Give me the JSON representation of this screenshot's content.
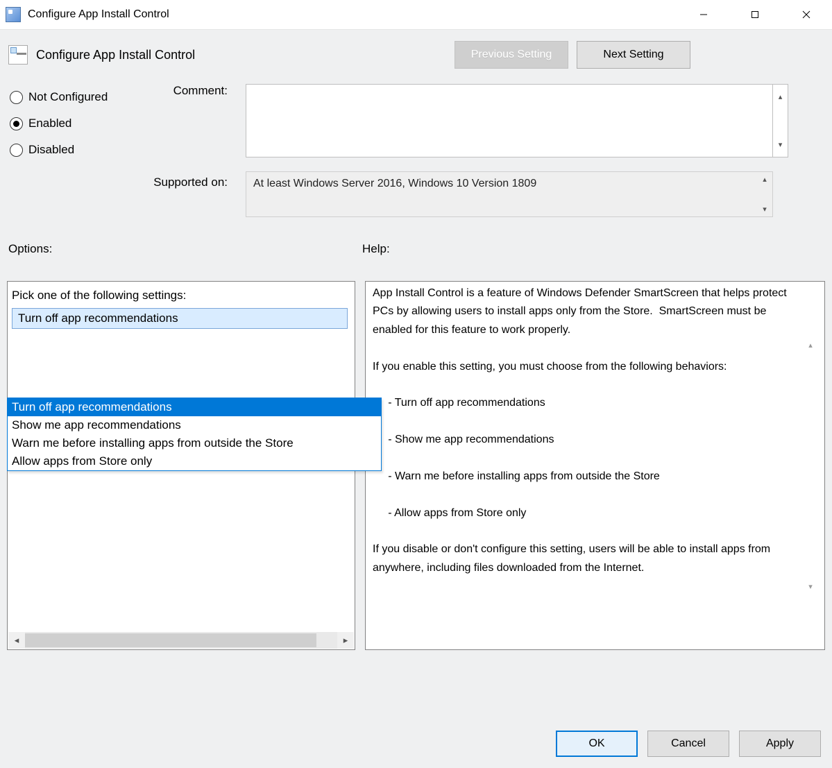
{
  "window": {
    "title": "Configure App Install Control"
  },
  "header": {
    "title": "Configure App Install Control",
    "prev_button": "Previous Setting",
    "next_button": "Next Setting"
  },
  "state": {
    "not_configured_label": "Not Configured",
    "enabled_label": "Enabled",
    "disabled_label": "Disabled",
    "selected": "Enabled"
  },
  "labels": {
    "comment": "Comment:",
    "supported_on": "Supported on:",
    "options": "Options:",
    "help": "Help:"
  },
  "comment_value": "",
  "supported_on_value": "At least Windows Server 2016, Windows 10 Version 1809",
  "options_panel": {
    "prompt": "Pick one of the following settings:",
    "selected_value": "Turn off app recommendations",
    "choices": [
      "Turn off app recommendations",
      "Show me app recommendations",
      "Warn me before installing apps from outside the Store",
      "Allow apps from Store only"
    ],
    "highlighted_index": 0
  },
  "help_text": "App Install Control is a feature of Windows Defender SmartScreen that helps protect PCs by allowing users to install apps only from the Store.  SmartScreen must be enabled for this feature to work properly.\n\nIf you enable this setting, you must choose from the following behaviors:\n\n     - Turn off app recommendations\n\n     - Show me app recommendations\n\n     - Warn me before installing apps from outside the Store\n\n     - Allow apps from Store only\n\nIf you disable or don't configure this setting, users will be able to install apps from anywhere, including files downloaded from the Internet.",
  "dialog_buttons": {
    "ok": "OK",
    "cancel": "Cancel",
    "apply": "Apply"
  }
}
